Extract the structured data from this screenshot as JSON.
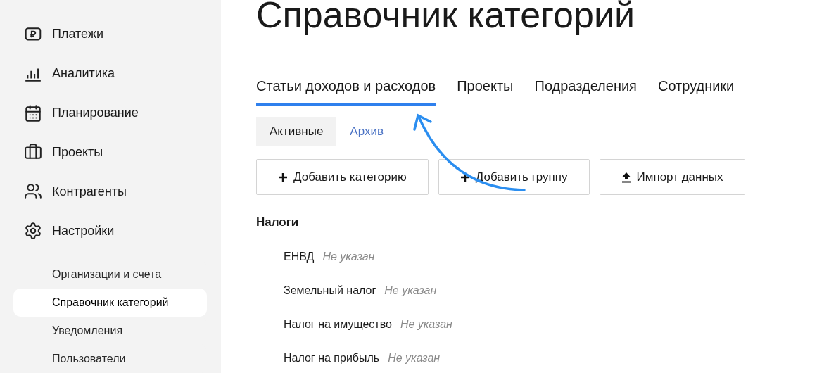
{
  "sidebar": {
    "items": [
      {
        "label": "Платежи",
        "kind": "ruble"
      },
      {
        "label": "Аналитика",
        "kind": "chart"
      },
      {
        "label": "Планирование",
        "kind": "calendar"
      },
      {
        "label": "Проекты",
        "kind": "briefcase"
      },
      {
        "label": "Контрагенты",
        "kind": "people"
      },
      {
        "label": "Настройки",
        "kind": "gear"
      }
    ],
    "subitems": [
      {
        "label": "Организации и счета",
        "selected": false
      },
      {
        "label": "Справочник категорий",
        "selected": true
      },
      {
        "label": "Уведомления",
        "selected": false
      },
      {
        "label": "Пользователи",
        "selected": false
      }
    ]
  },
  "title": "Справочник категорий",
  "tabs": [
    {
      "label": "Статьи доходов и расходов",
      "selected": true
    },
    {
      "label": "Проекты",
      "selected": false
    },
    {
      "label": "Подразделения",
      "selected": false
    },
    {
      "label": "Сотрудники",
      "selected": false
    }
  ],
  "subtabs": [
    {
      "label": "Активные",
      "selected": true
    },
    {
      "label": "Архив",
      "selected": false
    }
  ],
  "buttons": [
    {
      "label": "Добавить категорию",
      "kind": "plus"
    },
    {
      "label": "Добавить группу",
      "kind": "plus"
    },
    {
      "label": "Импорт данных",
      "kind": "upload"
    }
  ],
  "group": {
    "title": "Налоги",
    "items": [
      {
        "name": "ЕНВД",
        "note": "Не указан"
      },
      {
        "name": "Земельный налог",
        "note": "Не указан"
      },
      {
        "name": "Налог на имущество",
        "note": "Не указан"
      },
      {
        "name": "Налог на прибыль",
        "note": "Не указан"
      }
    ]
  }
}
